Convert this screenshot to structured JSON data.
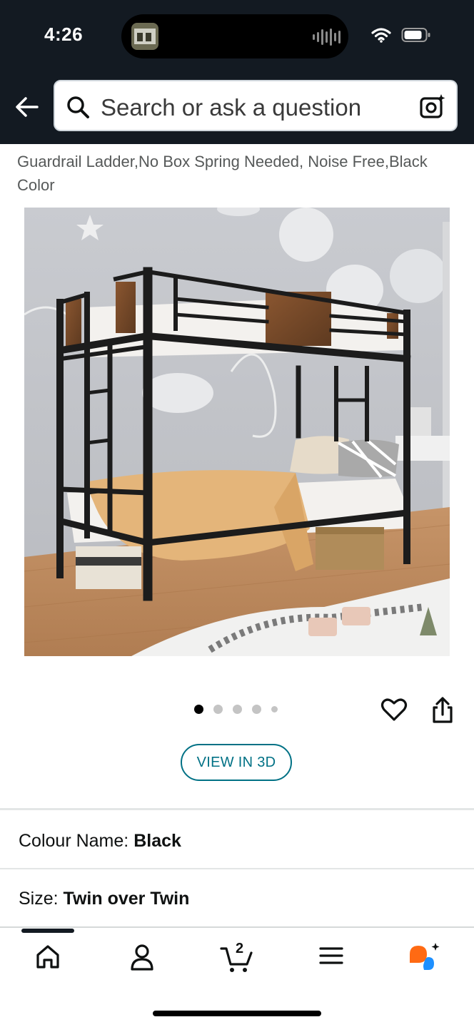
{
  "status": {
    "time": "4:26"
  },
  "search": {
    "placeholder": "Search or ask a question"
  },
  "product": {
    "title_line1": "Guardrail Ladder,No Box Spring Needed, Noise Free,Black",
    "title_line2": "Color",
    "image_count": 5,
    "active_image": 1,
    "view_3d_label": "VIEW IN 3D"
  },
  "options": {
    "colour_label": "Colour Name:",
    "colour_value": "Black",
    "size_label": "Size:",
    "size_value": "Twin over Twin"
  },
  "tabbar": {
    "items": [
      {
        "icon": "home-icon"
      },
      {
        "icon": "account-icon"
      },
      {
        "icon": "cart-icon",
        "badge": "2"
      },
      {
        "icon": "menu-icon"
      },
      {
        "icon": "rufus-assistant-icon"
      }
    ]
  },
  "colors": {
    "header_bg": "#131a22",
    "link": "#007185",
    "assistant_orange": "#ff6a13",
    "assistant_blue": "#1e90ff"
  }
}
